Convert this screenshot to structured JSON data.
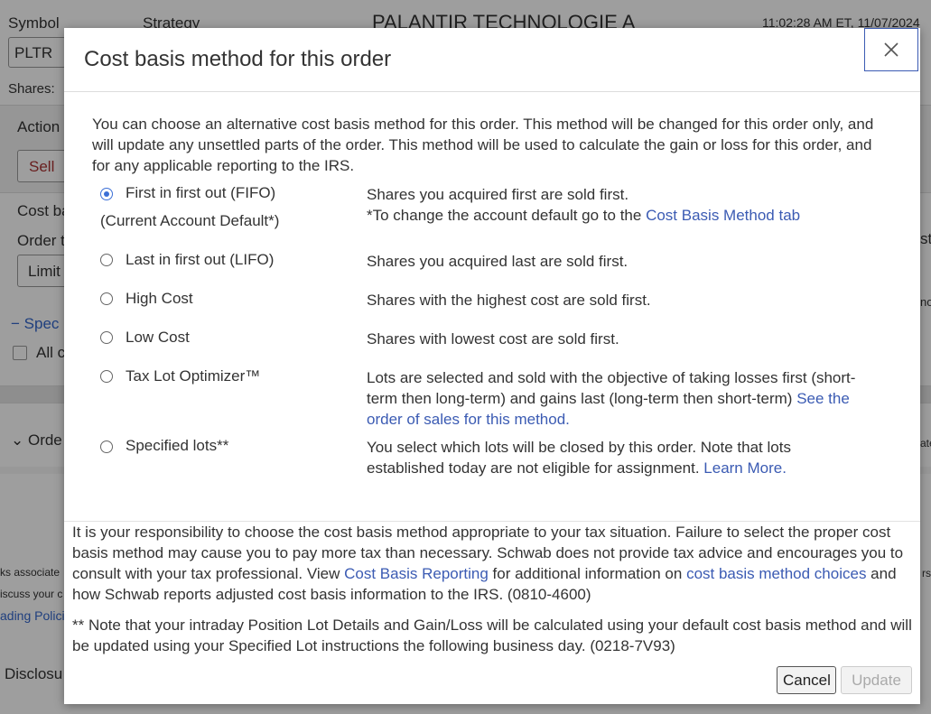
{
  "background": {
    "symbol_label": "Symbol",
    "strategy_label": "Strategy",
    "stock_title": "PALANTIR TECHNOLOGIE A",
    "timestamp": "11:02:28 AM ET, 11/07/2024",
    "symbol_value": "PLTR",
    "shares_label": "Shares:",
    "action_label": "Action",
    "action_value": "Sell",
    "cost_basis_label": "Cost ba",
    "order_type_label": "Order t",
    "order_type_value": "Limit",
    "specified_link": "Spec",
    "all_checkbox_label": "All c",
    "order_section": "Orde",
    "left_text_1": "ks associate",
    "left_text_2": "iscuss your c",
    "left_link": "ading Polici",
    "disclosure": "Disclosu",
    "right_frag_1": "st",
    "right_frag_2": "no",
    "right_frag_3": "ate",
    "right_frag_4": "rs"
  },
  "modal": {
    "title": "Cost basis method for this order",
    "intro": "You can choose an alternative cost basis method for this order. This method will be changed for this order only, and will update any unsettled parts of the order. This method will be used to calculate the gain or loss for this order, and for any applicable reporting to the IRS.",
    "options": [
      {
        "label": "First in first out (FIFO)",
        "sublabel": "(Current Account Default*)",
        "selected": true,
        "desc_1": "Shares you acquired first are sold first.",
        "desc_2": "*To change the account default go to the ",
        "desc_link": "Cost Basis Method tab"
      },
      {
        "label": "Last in first out (LIFO)",
        "selected": false,
        "desc": "Shares you acquired last are sold first."
      },
      {
        "label": "High Cost",
        "selected": false,
        "desc": "Shares with the highest cost are sold first."
      },
      {
        "label": "Low Cost",
        "selected": false,
        "desc": "Shares with lowest cost are sold first."
      },
      {
        "label": "Tax Lot Optimizer™",
        "selected": false,
        "desc": "Lots are selected and sold with the objective of taking losses first (short-term then long-term) and gains last (long-term then short-term) ",
        "desc_link": "See the order of sales for this method."
      },
      {
        "label": "Specified lots**",
        "selected": false,
        "desc": "You select which lots will be closed by this order. Note that lots established today are not eligible for assignment. ",
        "desc_link": "Learn More."
      }
    ],
    "disclaimer": {
      "part1": "It is your responsibility to choose the cost basis method appropriate to your tax situation. Failure to select the proper cost basis method may cause you to pay more tax than necessary. Schwab does not provide tax advice and encourages you to consult with your tax professional. View ",
      "link1": "Cost Basis Reporting",
      "part2": " for additional information on ",
      "link2": "cost basis method choices",
      "part3": " and how Schwab reports adjusted cost basis information to the IRS. (0810-4600)"
    },
    "note": "** Note that your intraday Position Lot Details and Gain/Loss will be calculated using your default cost basis method and will be updated using your Specified Lot instructions the following business day. (0218-7V93)",
    "cancel_label": "Cancel",
    "update_label": "Update"
  }
}
